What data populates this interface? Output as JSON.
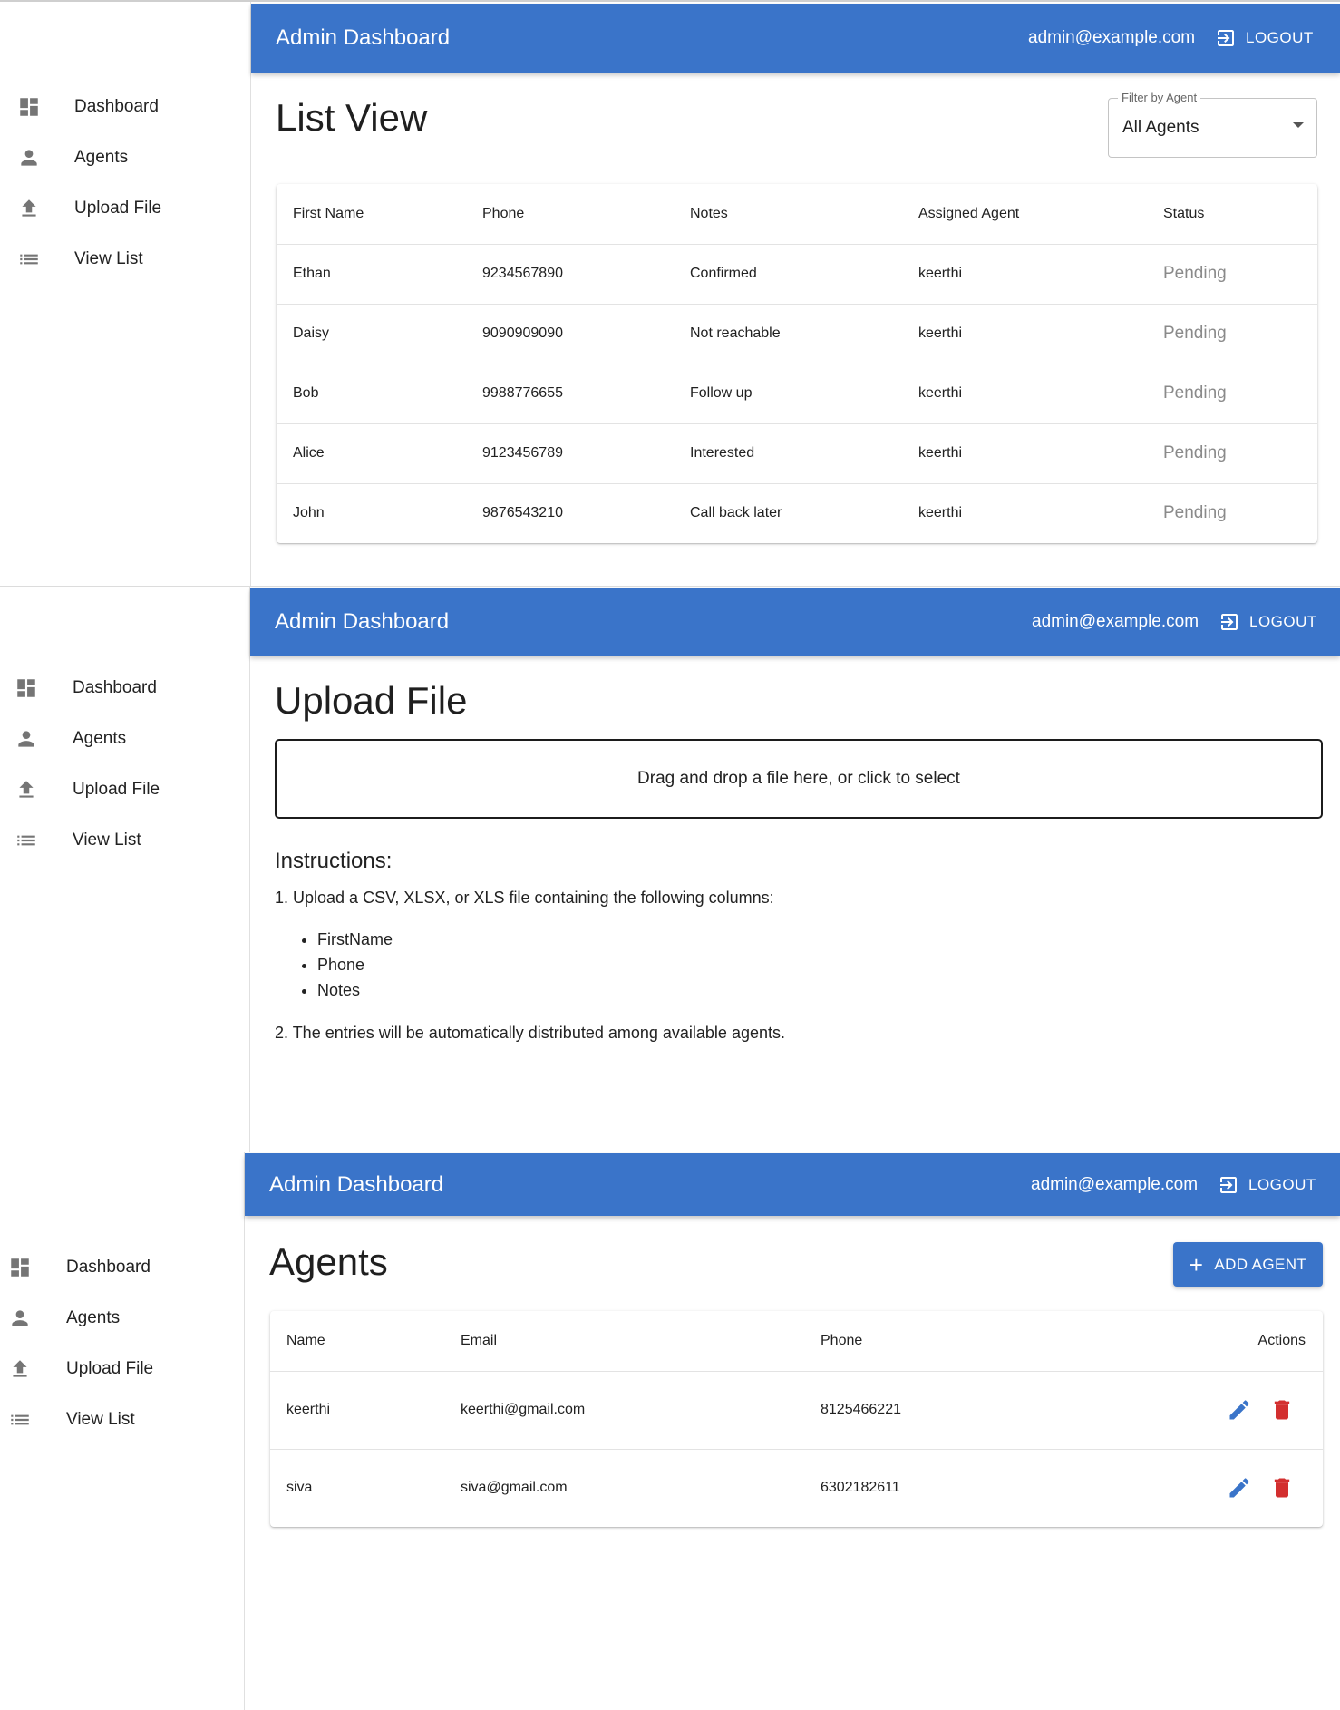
{
  "app": {
    "title": "Admin Dashboard",
    "user_email": "admin@example.com",
    "logout_label": "LOGOUT",
    "accent_color": "#3a74c9"
  },
  "sidebar": {
    "items": [
      {
        "label": "Dashboard",
        "icon": "dashboard-icon"
      },
      {
        "label": "Agents",
        "icon": "person-icon"
      },
      {
        "label": "Upload File",
        "icon": "upload-icon"
      },
      {
        "label": "View List",
        "icon": "list-icon"
      }
    ]
  },
  "list_view": {
    "title": "List View",
    "filter": {
      "label": "Filter by Agent",
      "value": "All Agents"
    },
    "columns": [
      "First Name",
      "Phone",
      "Notes",
      "Assigned Agent",
      "Status"
    ],
    "rows": [
      {
        "first_name": "Ethan",
        "phone": "9234567890",
        "notes": "Confirmed",
        "agent": "keerthi",
        "status": "Pending"
      },
      {
        "first_name": "Daisy",
        "phone": "9090909090",
        "notes": "Not reachable",
        "agent": "keerthi",
        "status": "Pending"
      },
      {
        "first_name": "Bob",
        "phone": "9988776655",
        "notes": "Follow up",
        "agent": "keerthi",
        "status": "Pending"
      },
      {
        "first_name": "Alice",
        "phone": "9123456789",
        "notes": "Interested",
        "agent": "keerthi",
        "status": "Pending"
      },
      {
        "first_name": "John",
        "phone": "9876543210",
        "notes": "Call back later",
        "agent": "keerthi",
        "status": "Pending"
      }
    ]
  },
  "upload": {
    "title": "Upload File",
    "dropzone_text": "Drag and drop a file here, or click to select",
    "instructions_title": "Instructions:",
    "step1": "1. Upload a CSV, XLSX, or XLS file containing the following columns:",
    "columns": [
      "FirstName",
      "Phone",
      "Notes"
    ],
    "step2": "2. The entries will be automatically distributed among available agents."
  },
  "agents": {
    "title": "Agents",
    "add_label": "ADD AGENT",
    "columns": [
      "Name",
      "Email",
      "Phone",
      "Actions"
    ],
    "rows": [
      {
        "name": "keerthi",
        "email": "keerthi@gmail.com",
        "phone": "8125466221"
      },
      {
        "name": "siva",
        "email": "siva@gmail.com",
        "phone": "6302182611"
      }
    ],
    "edit_color": "#3a74c9",
    "delete_color": "#d32f2f"
  }
}
